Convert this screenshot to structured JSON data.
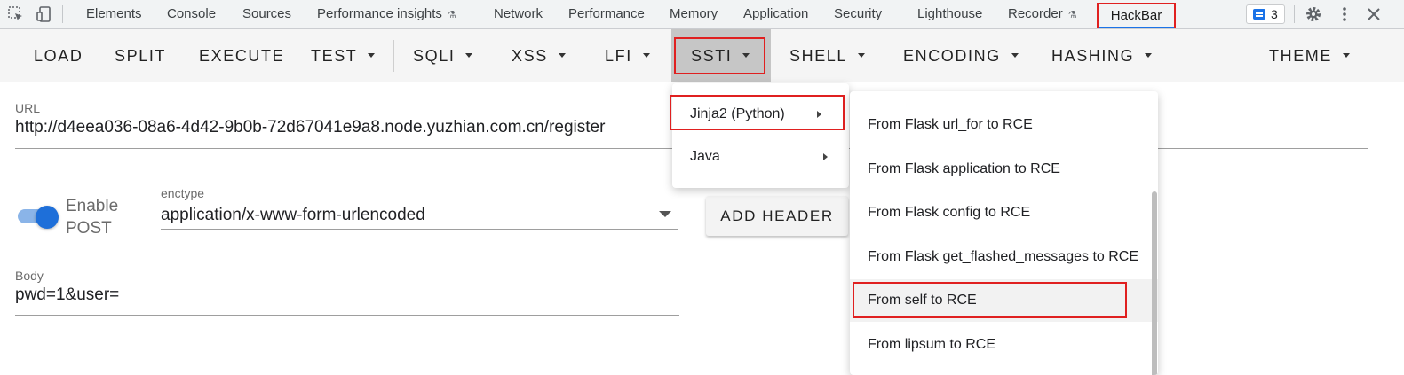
{
  "devtools": {
    "tabs": [
      {
        "label": "Elements"
      },
      {
        "label": "Console"
      },
      {
        "label": "Sources"
      },
      {
        "label": "Performance insights",
        "icon": "flask-icon"
      },
      {
        "label": "Network"
      },
      {
        "label": "Performance"
      },
      {
        "label": "Memory"
      },
      {
        "label": "Application"
      },
      {
        "label": "Security"
      },
      {
        "label": "Lighthouse"
      },
      {
        "label": "Recorder",
        "icon": "flask-icon"
      },
      {
        "label": "HackBar",
        "active": true
      }
    ],
    "issues_count": "3",
    "accent": "#1a73e8"
  },
  "toolbar": {
    "items": [
      "LOAD",
      "SPLIT",
      "EXECUTE",
      "TEST",
      "SQLI",
      "XSS",
      "LFI",
      "SSTI",
      "SHELL",
      "ENCODING",
      "HASHING",
      "THEME"
    ],
    "active": "SSTI"
  },
  "form": {
    "url_label": "URL",
    "url_value": "http://d4eea036-08a6-4d42-9b0b-72d67041e9a8.node.yuzhian.com.cn/register",
    "enable_post_label": "Enable POST",
    "enable_post_on": true,
    "enctype_label": "enctype",
    "enctype_value": "application/x-www-form-urlencoded",
    "add_header_label": "ADD HEADER",
    "body_label": "Body",
    "body_value": "pwd=1&user="
  },
  "ssti_menu": {
    "items": [
      "Jinja2 (Python)",
      "Java"
    ],
    "highlighted": "Jinja2 (Python)"
  },
  "jinja_submenu": {
    "items": [
      "From Flask url_for to RCE",
      "From Flask application to RCE",
      "From Flask config to RCE",
      "From Flask get_flashed_messages to RCE",
      "From self to RCE",
      "From lipsum to RCE"
    ],
    "highlighted": "From self to RCE"
  },
  "highlight_color": "#e02020"
}
